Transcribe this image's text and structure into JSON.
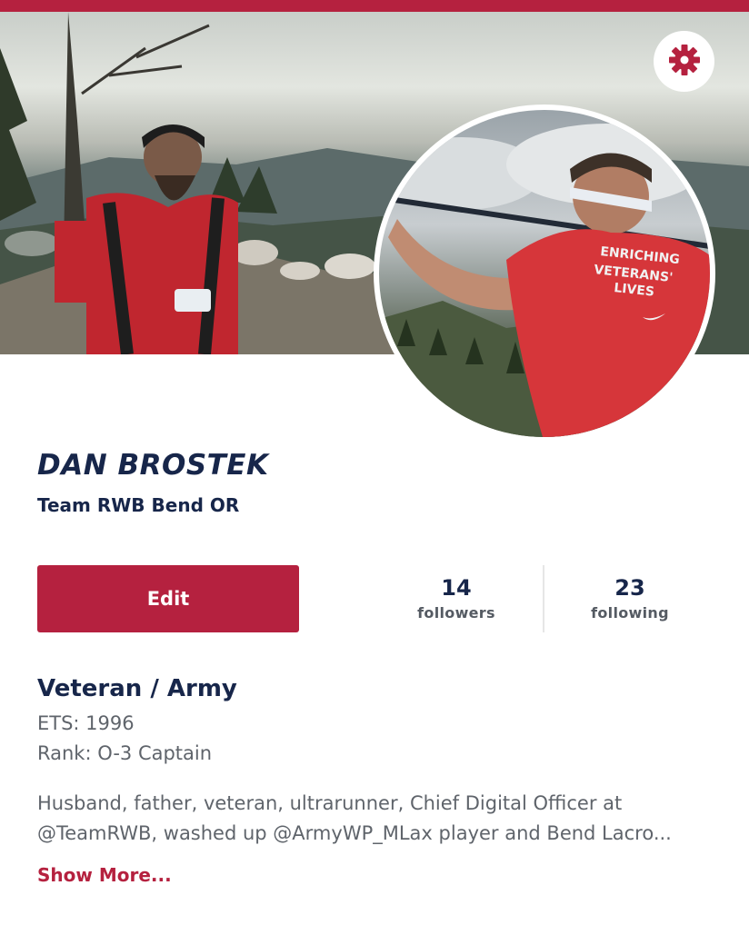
{
  "profile": {
    "name": "DAN BROSTEK",
    "chapter": "Team RWB Bend OR",
    "edit_label": "Edit",
    "followers_count": "14",
    "followers_label": "followers",
    "following_count": "23",
    "following_label": "following",
    "service": "Veteran / Army",
    "ets": "ETS: 1996",
    "rank": "Rank: O-3 Captain",
    "bio_line1": "Husband, father, veteran, ultrarunner, Chief Digital Officer at",
    "bio_line2": "@TeamRWB, washed up @ArmyWP_MLax player and Bend Lacro...",
    "show_more": "Show More...",
    "shirt_text": "ENRICHING VETERANS' LIVES"
  },
  "icons": {
    "settings": "gear-icon"
  },
  "colors": {
    "brand_red": "#b5213f",
    "navy": "#17264a",
    "gray_text": "#5f646b"
  }
}
